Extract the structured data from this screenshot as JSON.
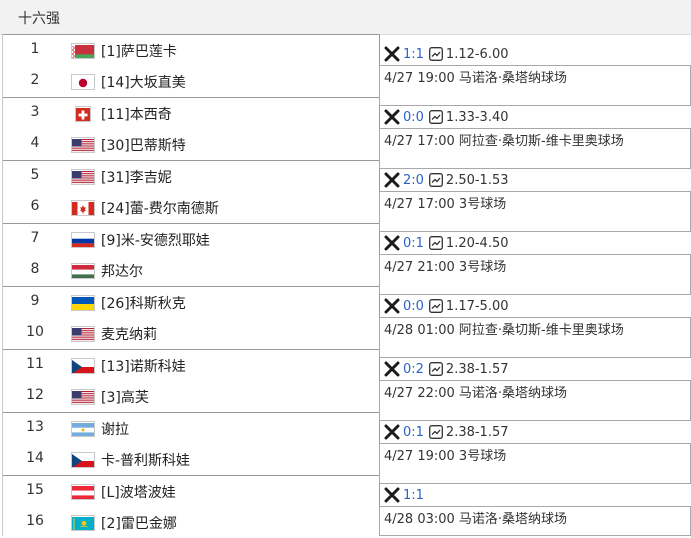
{
  "header": {
    "title": "十六强"
  },
  "players": [
    {
      "seed": "1",
      "name": "[1]萨巴莲卡",
      "flag": "flag-belarus"
    },
    {
      "seed": "2",
      "name": "[14]大坂直美",
      "flag": "flag-japan"
    },
    {
      "seed": "3",
      "name": "[11]本西奇",
      "flag": "flag-switzerland"
    },
    {
      "seed": "4",
      "name": "[30]巴蒂斯特",
      "flag": "flag-usa"
    },
    {
      "seed": "5",
      "name": "[31]李吉妮",
      "flag": "flag-usa"
    },
    {
      "seed": "6",
      "name": "[24]蕾-费尔南德斯",
      "flag": "flag-canada"
    },
    {
      "seed": "7",
      "name": "[9]米-安德烈耶娃",
      "flag": "flag-russia"
    },
    {
      "seed": "8",
      "name": "邦达尔",
      "flag": "flag-hungary"
    },
    {
      "seed": "9",
      "name": "[26]科斯秋克",
      "flag": "flag-ukraine"
    },
    {
      "seed": "10",
      "name": "麦克纳莉",
      "flag": "flag-usa"
    },
    {
      "seed": "11",
      "name": "[13]诺斯科娃",
      "flag": "flag-czech"
    },
    {
      "seed": "12",
      "name": "[3]高芙",
      "flag": "flag-usa"
    },
    {
      "seed": "13",
      "name": "谢拉",
      "flag": "flag-argentina"
    },
    {
      "seed": "14",
      "name": "卡-普利斯科娃",
      "flag": "flag-czech"
    },
    {
      "seed": "15",
      "name": "[L]波塔波娃",
      "flag": "flag-austria"
    },
    {
      "seed": "16",
      "name": "[2]雷巴金娜",
      "flag": "flag-kazakhstan"
    }
  ],
  "matches": [
    {
      "score": "1:1",
      "odds": "1.12-6.00",
      "info": "4/27 19:00 马诺洛·桑塔纳球场"
    },
    {
      "score": "0:0",
      "odds": "1.33-3.40",
      "info": "4/27 17:00 阿拉查·桑切斯-维卡里奥球场"
    },
    {
      "score": "2:0",
      "odds": "2.50-1.53",
      "info": "4/27 17:00 3号球场"
    },
    {
      "score": "0:1",
      "odds": "1.20-4.50",
      "info": "4/27 21:00 3号球场"
    },
    {
      "score": "0:0",
      "odds": "1.17-5.00",
      "info": "4/28 01:00 阿拉查·桑切斯-维卡里奥球场"
    },
    {
      "score": "0:2",
      "odds": "2.38-1.57",
      "info": "4/27 22:00 马诺洛·桑塔纳球场"
    },
    {
      "score": "0:1",
      "odds": "2.38-1.57",
      "info": "4/27 19:00 3号球场"
    },
    {
      "score": "1:1",
      "odds": "",
      "info": "4/28 03:00 马诺洛·桑塔纳球场"
    }
  ]
}
